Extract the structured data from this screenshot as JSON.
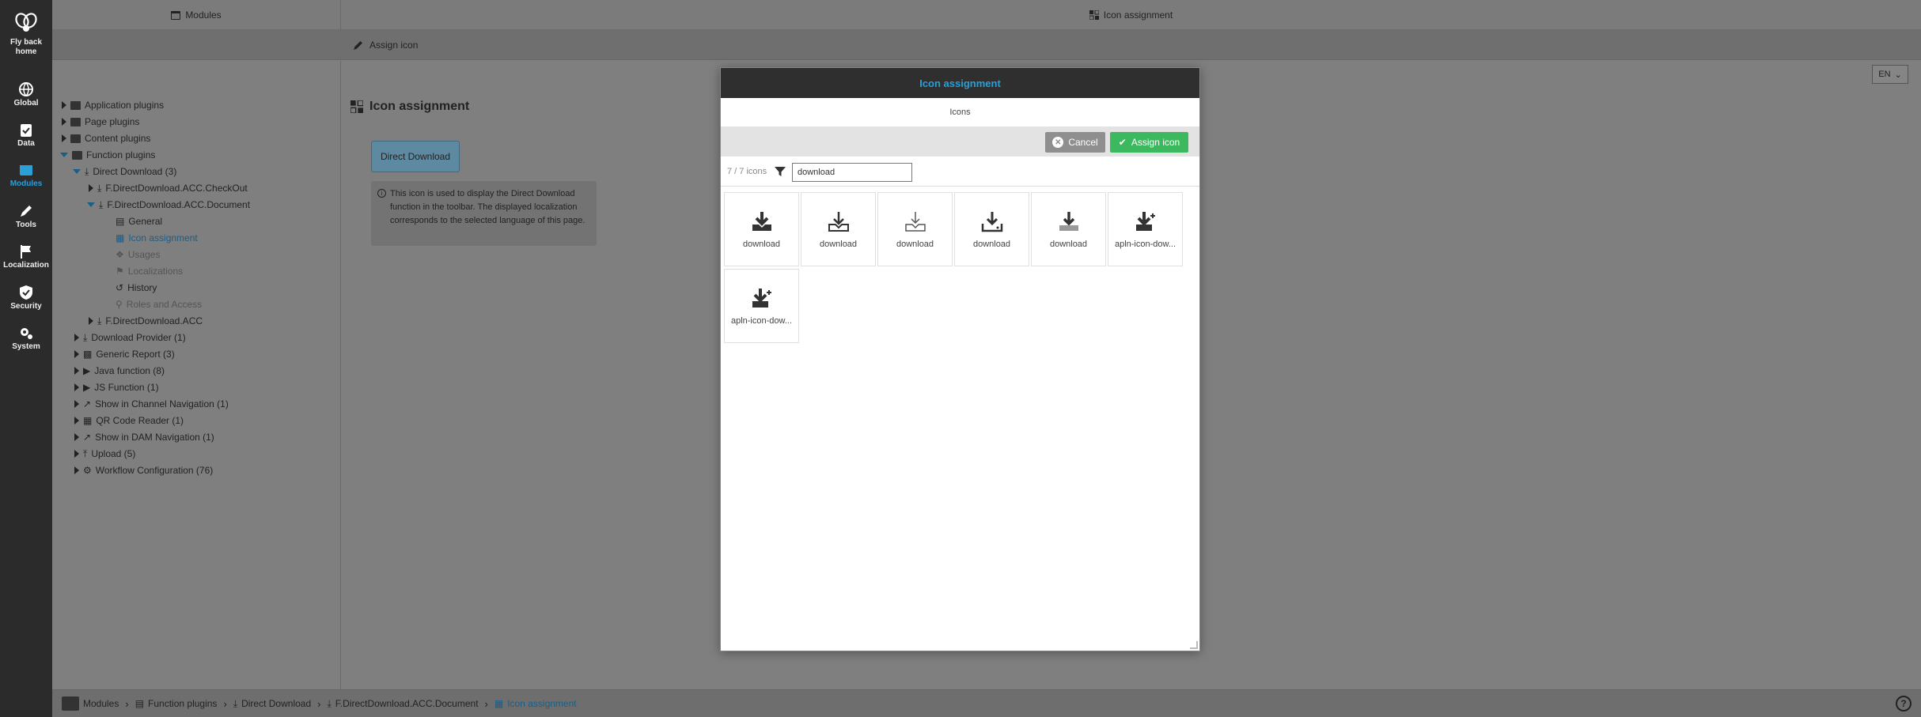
{
  "nav": {
    "items": [
      {
        "label": "Fly back home",
        "icon": "bee-logo-icon"
      },
      {
        "label": "Global",
        "icon": "globe-icon"
      },
      {
        "label": "Data",
        "icon": "clipboard-icon"
      },
      {
        "label": "Modules",
        "icon": "modules-icon"
      },
      {
        "label": "Tools",
        "icon": "pencil-icon"
      },
      {
        "label": "Localization",
        "icon": "flag-icon"
      },
      {
        "label": "Security",
        "icon": "shield-icon"
      },
      {
        "label": "System",
        "icon": "gears-icon"
      }
    ],
    "fly_back_line1": "Fly back",
    "fly_back_line2": "home",
    "active": "Modules"
  },
  "top": {
    "left_tab": "Modules",
    "right_tab": "Icon assignment"
  },
  "toolbar": {
    "assign_label": "Assign icon"
  },
  "language": "EN",
  "tree": {
    "rows": [
      {
        "label": "Application plugins"
      },
      {
        "label": "Page plugins"
      },
      {
        "label": "Content plugins"
      },
      {
        "label": "Function plugins"
      },
      {
        "label": "Direct Download (3)"
      },
      {
        "label": "F.DirectDownload.ACC.CheckOut"
      },
      {
        "label": "F.DirectDownload.ACC.Document"
      },
      {
        "label": "General"
      },
      {
        "label": "Icon assignment"
      },
      {
        "label": "Usages"
      },
      {
        "label": "Localizations"
      },
      {
        "label": "History"
      },
      {
        "label": "Roles and Access"
      },
      {
        "label": "F.DirectDownload.ACC"
      },
      {
        "label": "Download Provider (1)"
      },
      {
        "label": "Generic Report (3)"
      },
      {
        "label": "Java function (8)"
      },
      {
        "label": "JS Function (1)"
      },
      {
        "label": "Show in Channel Navigation (1)"
      },
      {
        "label": "QR Code Reader (1)"
      },
      {
        "label": "Show in DAM Navigation (1)"
      },
      {
        "label": "Upload (5)"
      },
      {
        "label": "Workflow Configuration (76)"
      }
    ]
  },
  "content": {
    "title": "Icon assignment",
    "button_label": "Direct Download",
    "info_text": "This icon is used to display the Direct Download function in the toolbar. The displayed localization corresponds to the selected language of this page."
  },
  "modal": {
    "title": "Icon assignment",
    "subtitle": "Icons",
    "cancel_label": "Cancel",
    "assign_label": "Assign icon",
    "count": "7 / 7 icons",
    "search_value": "download",
    "icons": [
      {
        "label": "download",
        "variant": "solid"
      },
      {
        "label": "download",
        "variant": "outline"
      },
      {
        "label": "download",
        "variant": "thin"
      },
      {
        "label": "download",
        "variant": "tray"
      },
      {
        "label": "download",
        "variant": "shadow"
      },
      {
        "label": "apln-icon-dow...",
        "variant": "plus"
      },
      {
        "label": "apln-icon-dow...",
        "variant": "plus-small"
      }
    ]
  },
  "breadcrumb": [
    {
      "label": "Modules"
    },
    {
      "label": "Function plugins"
    },
    {
      "label": "Direct Download"
    },
    {
      "label": "F.DirectDownload.ACC.Document"
    },
    {
      "label": "Icon assignment"
    }
  ],
  "colors": {
    "accent": "#2a9fd8",
    "assign_green": "#3cb95e",
    "nav_bg": "#2b2b2b"
  }
}
